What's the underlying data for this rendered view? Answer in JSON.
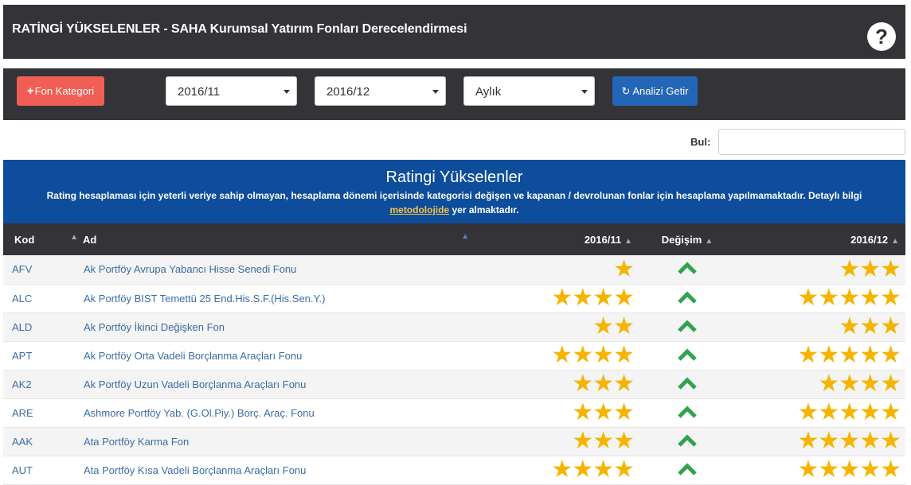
{
  "header": {
    "title": "RATİNGİ YÜKSELENLER - SAHA Kurumsal Yatırım Fonları Derecelendirmesi",
    "help_icon": "question-icon"
  },
  "toolbar": {
    "category_button": "Fon Kategori",
    "start_period": "2016/11",
    "end_period": "2016/12",
    "frequency": "Aylık",
    "analyze_button": "Analizi Getir"
  },
  "search": {
    "label": "Bul:",
    "value": ""
  },
  "panel": {
    "title": "Ratingi Yükselenler",
    "desc_before": "Rating hesaplaması için yeterli veriye sahip olmayan, hesaplama dönemi içerisinde kategorisi değişen ve kapanan / devrolunan fonlar için hesaplama yapılmamaktadır. Detaylı bilgi ",
    "desc_link": "metodolojide",
    "desc_after": " yer almaktadır."
  },
  "table": {
    "headers": {
      "code": "Kod",
      "name": "Ad",
      "prev": "2016/11",
      "change": "Değişim",
      "curr": "2016/12"
    },
    "rows": [
      {
        "code": "AFV",
        "name": "Ak Portföy Avrupa Yabancı Hisse Senedi Fonu",
        "prev": "★",
        "curr": "★★★"
      },
      {
        "code": "ALC",
        "name": "Ak Portföy BIST Temettü 25 End.His.S.F.(His.Sen.Y.)",
        "prev": "★★★★",
        "curr": "★★★★★"
      },
      {
        "code": "ALD",
        "name": "Ak Portföy İkinci Değişken Fon",
        "prev": "★★",
        "curr": "★★★"
      },
      {
        "code": "APT",
        "name": "Ak Portföy Orta Vadeli Borçlanma Araçları Fonu",
        "prev": "★★★★",
        "curr": "★★★★★"
      },
      {
        "code": "AK2",
        "name": "Ak Portföy Uzun Vadeli Borçlanma Araçları Fonu",
        "prev": "★★★",
        "curr": "★★★★"
      },
      {
        "code": "ARE",
        "name": "Ashmore Portföy Yab. (G.Ol.Piy.) Borç. Araç. Fonu",
        "prev": "★★★",
        "curr": "★★★★★"
      },
      {
        "code": "AAK",
        "name": "Ata Portföy Karma Fon",
        "prev": "★★★",
        "curr": "★★★★★"
      },
      {
        "code": "AUT",
        "name": "Ata Portföy Kısa Vadeli Borçlanma Araçları Fonu",
        "prev": "★★★★",
        "curr": "★★★★★"
      }
    ]
  },
  "colors": {
    "star": "#f5b400",
    "up_arrow": "#2ea44f",
    "header_bg": "#333338",
    "panel_bg": "#0d4d9b"
  }
}
